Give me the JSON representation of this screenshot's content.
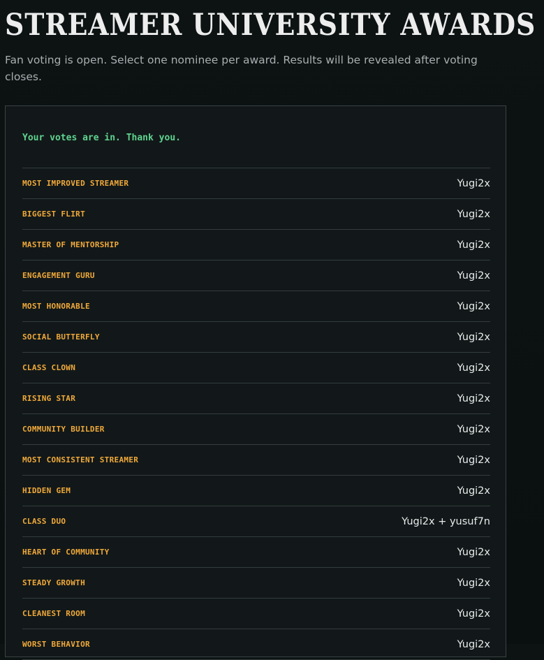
{
  "header": {
    "title": "STREAMER UNIVERSITY AWARDS",
    "subtitle": "Fan voting is open. Select one nominee per award. Results will be revealed after voting closes."
  },
  "panel": {
    "confirmation": "Your votes are in. Thank you.",
    "results": [
      {
        "award": "MOST IMPROVED STREAMER",
        "nominee": "Yugi2x"
      },
      {
        "award": "BIGGEST FLIRT",
        "nominee": "Yugi2x"
      },
      {
        "award": "MASTER OF MENTORSHIP",
        "nominee": "Yugi2x"
      },
      {
        "award": "ENGAGEMENT GURU",
        "nominee": "Yugi2x"
      },
      {
        "award": "MOST HONORABLE",
        "nominee": "Yugi2x"
      },
      {
        "award": "SOCIAL BUTTERFLY",
        "nominee": "Yugi2x"
      },
      {
        "award": "CLASS CLOWN",
        "nominee": "Yugi2x"
      },
      {
        "award": "RISING STAR",
        "nominee": "Yugi2x"
      },
      {
        "award": "COMMUNITY BUILDER",
        "nominee": "Yugi2x"
      },
      {
        "award": "MOST CONSISTENT STREAMER",
        "nominee": "Yugi2x"
      },
      {
        "award": "HIDDEN GEM",
        "nominee": "Yugi2x"
      },
      {
        "award": "CLASS DUO",
        "nominee": "Yugi2x + yusuf7n"
      },
      {
        "award": "HEART OF COMMUNITY",
        "nominee": "Yugi2x"
      },
      {
        "award": "STEADY GROWTH",
        "nominee": "Yugi2x"
      },
      {
        "award": "CLEANEST ROOM",
        "nominee": "Yugi2x"
      },
      {
        "award": "WORST BEHAVIOR",
        "nominee": "Yugi2x"
      }
    ]
  },
  "colors": {
    "accent_award": "#f0a93a",
    "confirmation_green": "#5fd38f",
    "background": "#0b1011",
    "panel_background": "#121819"
  }
}
